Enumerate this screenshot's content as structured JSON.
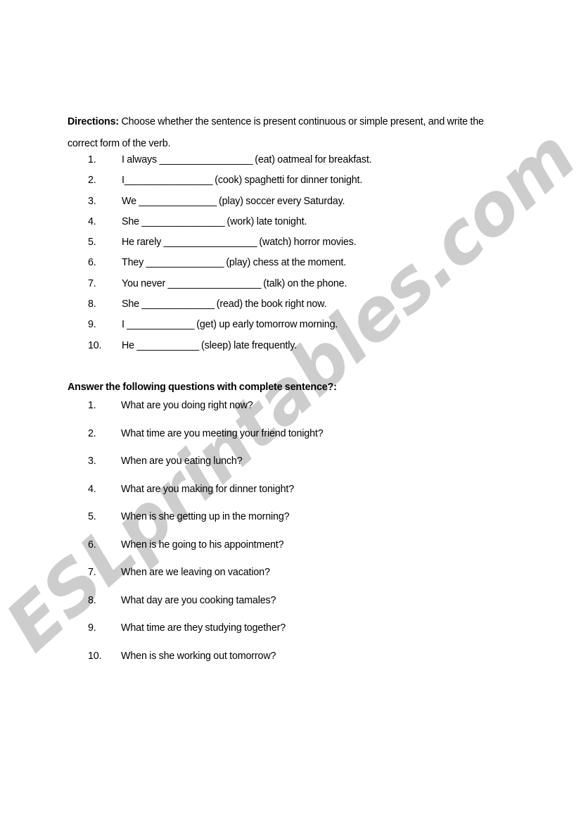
{
  "document": {
    "type": "worksheet",
    "watermark": {
      "text": "ESLprintables.com",
      "color": "#cdcdcd"
    },
    "directions": {
      "label": "Directions:",
      "body": " Choose whether the sentence is present continuous or simple present, and write the correct form of the verb."
    },
    "exercise_1": {
      "items": [
        {
          "num": "1.",
          "before": "I always ",
          "blank": "__________________",
          "after": " (eat) oatmeal for breakfast."
        },
        {
          "num": "2.",
          "before": "I",
          "blank": "_________________",
          "after": " (cook) spaghetti for dinner tonight."
        },
        {
          "num": "3.",
          "before": "We ",
          "blank": "_______________",
          "after": " (play) soccer every Saturday."
        },
        {
          "num": "4.",
          "before": "She ",
          "blank": "________________",
          "after": " (work) late tonight."
        },
        {
          "num": "5.",
          "before": "He rarely ",
          "blank": "__________________",
          "after": "  (watch) horror movies."
        },
        {
          "num": "6.",
          "before": "They ",
          "blank": "_______________",
          "after": " (play) chess at the moment."
        },
        {
          "num": "7.",
          "before": "You never ",
          "blank": "__________________",
          "after": " (talk) on the phone."
        },
        {
          "num": "8.",
          "before": "She ",
          "blank": "______________",
          "after": " (read) the book right now."
        },
        {
          "num": "9.",
          "before": "I ",
          "blank": "_____________",
          "after": " (get) up early tomorrow morning."
        },
        {
          "num": "10.",
          "before": "He ",
          "blank": "____________",
          "after": " (sleep) late frequently."
        }
      ]
    },
    "exercise_2": {
      "heading": "Answer the following questions with complete sentence?:",
      "items": [
        {
          "num": "1.",
          "text": "What are you doing right now?"
        },
        {
          "num": "2.",
          "text": "What time are you meeting your friend tonight?"
        },
        {
          "num": "3.",
          "text": "When are you eating lunch?"
        },
        {
          "num": "4.",
          "text": "What are you making for dinner tonight?"
        },
        {
          "num": "5.",
          "text": "When is she getting up in the morning?"
        },
        {
          "num": "6.",
          "text": "When is he going to his appointment?"
        },
        {
          "num": "7.",
          "text": "When are we leaving on vacation?"
        },
        {
          "num": "8.",
          "text": "What day are you cooking tamales?"
        },
        {
          "num": "9.",
          "text": "What time are they studying together?"
        },
        {
          "num": "10.",
          "text": "When is she working out tomorrow?"
        }
      ]
    }
  }
}
